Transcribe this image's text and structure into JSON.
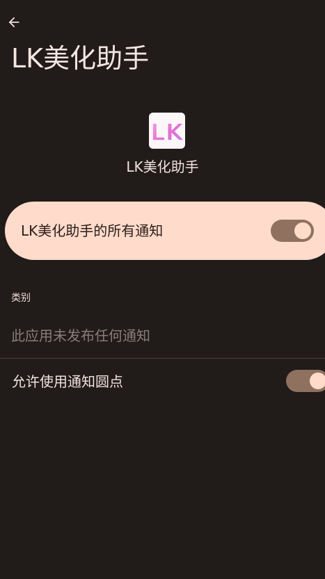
{
  "header": {
    "title": "LK美化助手",
    "back_icon": "arrow-left-icon"
  },
  "app": {
    "name": "LK美化助手",
    "icon_text": "LK"
  },
  "master_toggle": {
    "label": "LK美化助手的所有通知",
    "checked": true
  },
  "categories": {
    "header": "类别",
    "empty_text": "此应用未发布任何通知"
  },
  "notification_dot": {
    "label": "允许使用通知圆点",
    "checked": true
  },
  "colors": {
    "background": "#211b1a",
    "card": "#ffdbcb",
    "switch_track": "#8f7160",
    "switch_knob": "#ffdcc9"
  }
}
